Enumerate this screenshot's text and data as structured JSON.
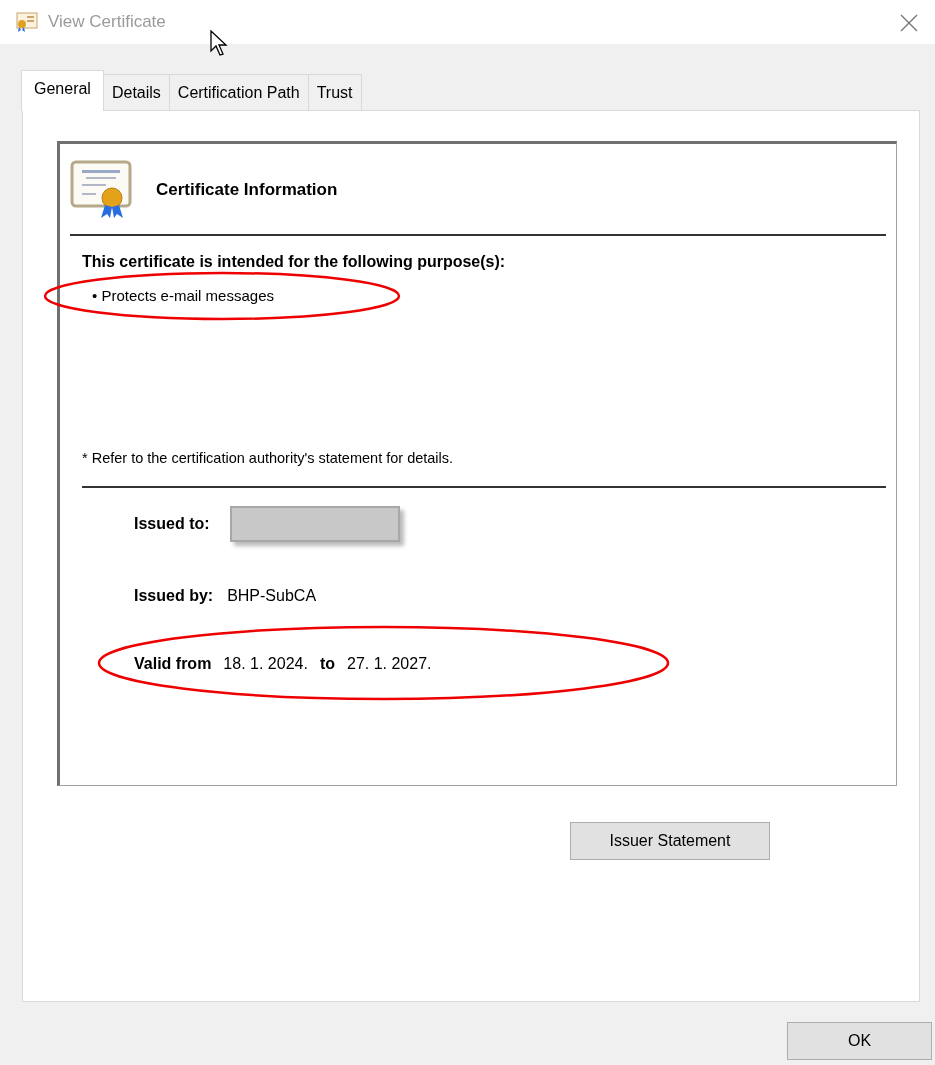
{
  "window": {
    "title": "View Certificate",
    "active": false
  },
  "tabs": [
    {
      "label": "General",
      "selected": true
    },
    {
      "label": "Details",
      "selected": false
    },
    {
      "label": "Certification Path",
      "selected": false
    },
    {
      "label": "Trust",
      "selected": false
    }
  ],
  "info": {
    "heading": "Certificate Information",
    "purpose_title": "This certificate is intended for the following purpose(s):",
    "purposes": [
      {
        "text": "• Protects e-mail messages",
        "highlighted": true
      }
    ],
    "note": "* Refer to the certification authority's statement for details.",
    "fields": [
      {
        "kind": "redacted",
        "label": "Issued to:"
      },
      {
        "kind": "text",
        "label": "Issued by:",
        "value": "BHP-SubCA"
      }
    ],
    "validity": {
      "from_label": "Valid from",
      "from": "18. 1. 2024.",
      "to_label": "to",
      "to": "27. 1. 2027.",
      "highlighted": true
    }
  },
  "buttons": [
    {
      "label": "Issuer Statement",
      "kind": "panel"
    },
    {
      "label": "OK",
      "kind": "footer"
    }
  ]
}
